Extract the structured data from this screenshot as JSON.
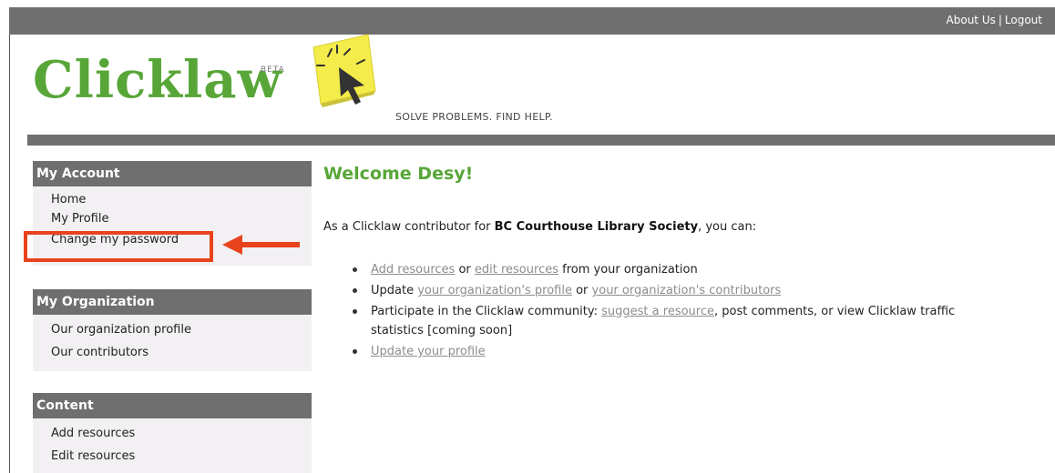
{
  "header": {
    "about_us": "About Us",
    "separator": "|",
    "logout": "Logout",
    "logo_text": "Clicklaw",
    "beta": "BETA",
    "tagline": "SOLVE PROBLEMS. FIND HELP."
  },
  "sidebar": {
    "account": {
      "title": "My Account",
      "items": [
        "Home",
        "My Profile",
        "Change my password"
      ]
    },
    "organization": {
      "title": "My Organization",
      "items": [
        "Our organization profile",
        "Our contributors"
      ]
    },
    "content": {
      "title": "Content",
      "items": [
        "Add resources",
        "Edit resources"
      ]
    }
  },
  "main": {
    "welcome": "Welcome Desy!",
    "intro_prefix": "As a Clicklaw contributor for ",
    "org_name": "BC Courthouse Library Society",
    "intro_suffix": ", you can:",
    "bullet1": {
      "link1": "Add resources",
      "text1": " or ",
      "link2": "edit resources",
      "text2": " from your organization"
    },
    "bullet2": {
      "text1": "Update ",
      "link1": "your organization's profile",
      "text2": " or ",
      "link2": "your organization's contributors"
    },
    "bullet3": {
      "text1": "Participate in the Clicklaw community: ",
      "link1": "suggest a resource",
      "text2": ", post comments, or view Clicklaw traffic statistics [coming soon]"
    },
    "bullet4": {
      "link1": "Update your profile"
    }
  },
  "colors": {
    "brand_green": "#57a637",
    "bar_gray": "#6f6f6f",
    "highlight_red": "#e8431c",
    "sticky_yellow": "#f3ec4a"
  },
  "icons": [
    "cursor-sticky-note-icon",
    "arrow-left-icon"
  ]
}
